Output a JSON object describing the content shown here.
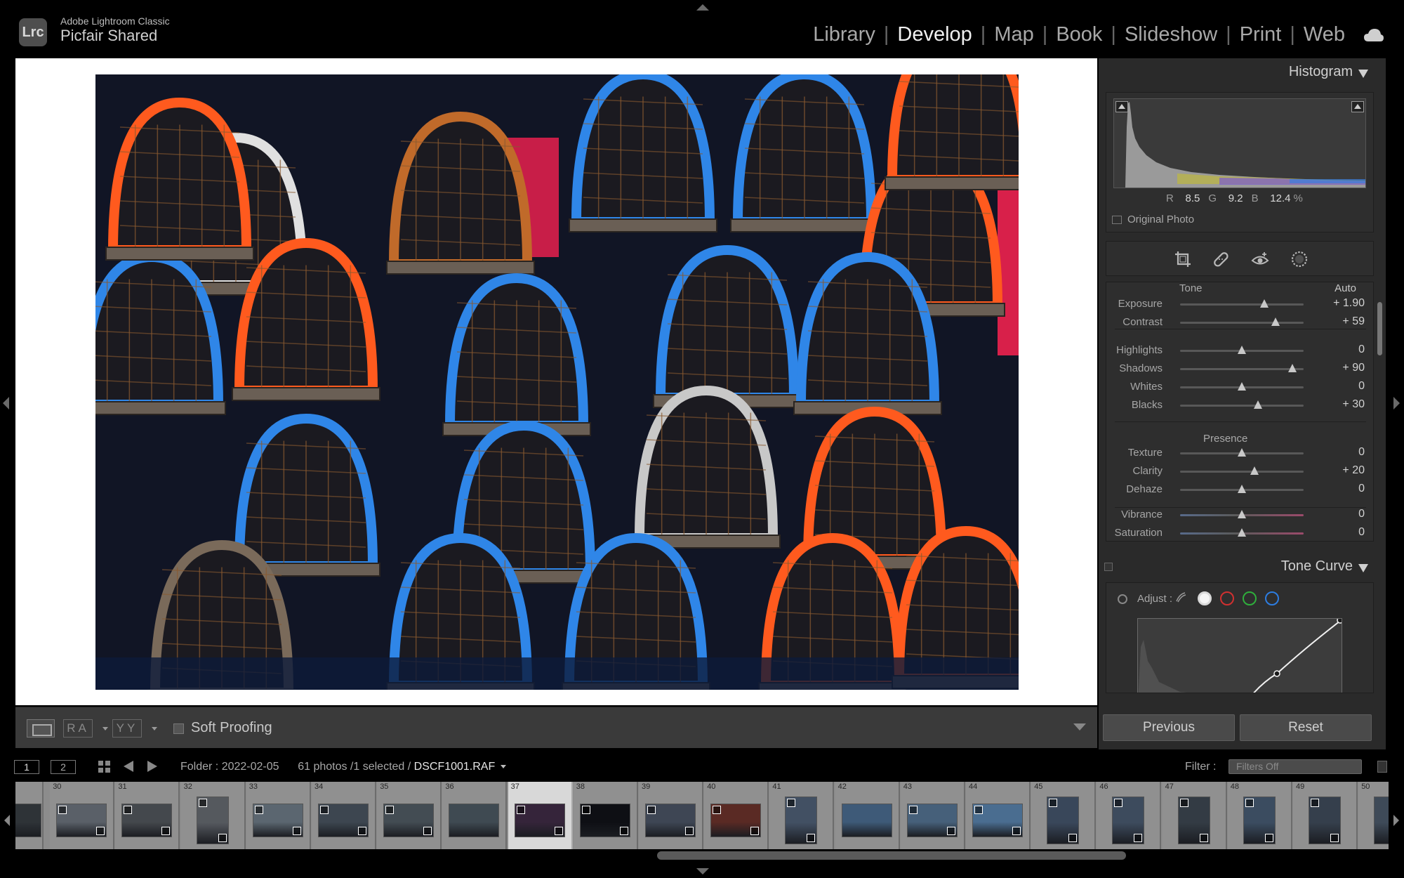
{
  "app": {
    "product_name": "Adobe Lightroom Classic",
    "catalog_name": "Picfair Shared",
    "logo_text": "Lrc"
  },
  "modules": [
    {
      "label": "Library",
      "active": false
    },
    {
      "label": "Develop",
      "active": true
    },
    {
      "label": "Map",
      "active": false
    },
    {
      "label": "Book",
      "active": false
    },
    {
      "label": "Slideshow",
      "active": false
    },
    {
      "label": "Print",
      "active": false
    },
    {
      "label": "Web",
      "active": false
    }
  ],
  "toolbar": {
    "before_after_ra": "RA",
    "before_after_yy": "YY",
    "soft_proofing_label": "Soft Proofing",
    "soft_proofing_checked": false
  },
  "histogram": {
    "title": "Histogram",
    "r_label": "R",
    "r_value": "8.5",
    "g_label": "G",
    "g_value": "9.2",
    "b_label": "B",
    "b_value": "12.4",
    "percent": "%",
    "original_photo_label": "Original Photo"
  },
  "tools": [
    "crop-tool",
    "healing-tool",
    "red-eye-tool",
    "masking-tool"
  ],
  "basic": {
    "tone_label": "Tone",
    "auto_label": "Auto",
    "presence_label": "Presence",
    "sliders": [
      {
        "label": "Exposure",
        "value": "+ 1.90",
        "pos": 0.68
      },
      {
        "label": "Contrast",
        "value": "+ 59",
        "pos": 0.77
      },
      {
        "label": "Highlights",
        "value": "0",
        "pos": 0.5
      },
      {
        "label": "Shadows",
        "value": "+ 90",
        "pos": 0.91
      },
      {
        "label": "Whites",
        "value": "0",
        "pos": 0.5
      },
      {
        "label": "Blacks",
        "value": "+ 30",
        "pos": 0.63
      },
      {
        "label": "Texture",
        "value": "0",
        "pos": 0.5
      },
      {
        "label": "Clarity",
        "value": "+ 20",
        "pos": 0.6
      },
      {
        "label": "Dehaze",
        "value": "0",
        "pos": 0.5
      },
      {
        "label": "Vibrance",
        "value": "0",
        "pos": 0.5
      },
      {
        "label": "Saturation",
        "value": "0",
        "pos": 0.5
      }
    ]
  },
  "tone_curve": {
    "title": "Tone Curve",
    "adjust_label": "Adjust :",
    "channels": [
      {
        "name": "parametric",
        "color": "#9a9a9a"
      },
      {
        "name": "rgb",
        "color": "#d9d9d9"
      },
      {
        "name": "red",
        "color": "#d03030"
      },
      {
        "name": "green",
        "color": "#2fae3c"
      },
      {
        "name": "blue",
        "color": "#2d7de0"
      }
    ]
  },
  "buttons": {
    "previous": "Previous",
    "reset": "Reset"
  },
  "filmstrip_bar": {
    "view1": "1",
    "view2": "2",
    "folder_text": "Folder : 2022-02-05",
    "count_text": "61 photos /1 selected /",
    "filename": "DSCF1001.RAF",
    "filter_label": "Filter :",
    "filter_value": "Filters Off"
  },
  "filmstrip": {
    "selected_number": "37",
    "cells": [
      {
        "num": "",
        "orient": "landscape",
        "tone": "#2e3337",
        "badge": false
      },
      {
        "num": "30",
        "orient": "landscape",
        "tone": "#5a6068",
        "badge": true
      },
      {
        "num": "31",
        "orient": "landscape",
        "tone": "#44484d",
        "badge": true
      },
      {
        "num": "32",
        "orient": "portrait",
        "tone": "#55595e",
        "badge": true
      },
      {
        "num": "33",
        "orient": "landscape",
        "tone": "#5b6670",
        "badge": true
      },
      {
        "num": "34",
        "orient": "landscape",
        "tone": "#3d4650",
        "badge": true
      },
      {
        "num": "35",
        "orient": "landscape",
        "tone": "#434c53",
        "badge": true
      },
      {
        "num": "36",
        "orient": "landscape",
        "tone": "#3f4a52",
        "badge": false
      },
      {
        "num": "37",
        "orient": "landscape",
        "tone": "#35243a",
        "badge": true
      },
      {
        "num": "38",
        "orient": "landscape",
        "tone": "#0e0f14",
        "badge": true
      },
      {
        "num": "39",
        "orient": "landscape",
        "tone": "#3e4654",
        "badge": true
      },
      {
        "num": "40",
        "orient": "landscape",
        "tone": "#5a2a24",
        "badge": true
      },
      {
        "num": "41",
        "orient": "portrait",
        "tone": "#425063",
        "badge": true
      },
      {
        "num": "42",
        "orient": "landscape",
        "tone": "#3e5a78",
        "badge": false
      },
      {
        "num": "43",
        "orient": "landscape",
        "tone": "#46607a",
        "badge": true
      },
      {
        "num": "44",
        "orient": "landscape",
        "tone": "#4a6d90",
        "badge": true
      },
      {
        "num": "45",
        "orient": "portrait",
        "tone": "#39475a",
        "badge": true
      },
      {
        "num": "46",
        "orient": "portrait",
        "tone": "#3d4b5d",
        "badge": true
      },
      {
        "num": "47",
        "orient": "portrait",
        "tone": "#333b44",
        "badge": true
      },
      {
        "num": "48",
        "orient": "portrait",
        "tone": "#3b4c60",
        "badge": true
      },
      {
        "num": "49",
        "orient": "portrait",
        "tone": "#353f4c",
        "badge": true
      },
      {
        "num": "50",
        "orient": "portrait",
        "tone": "#3e4a58",
        "badge": false
      }
    ]
  }
}
